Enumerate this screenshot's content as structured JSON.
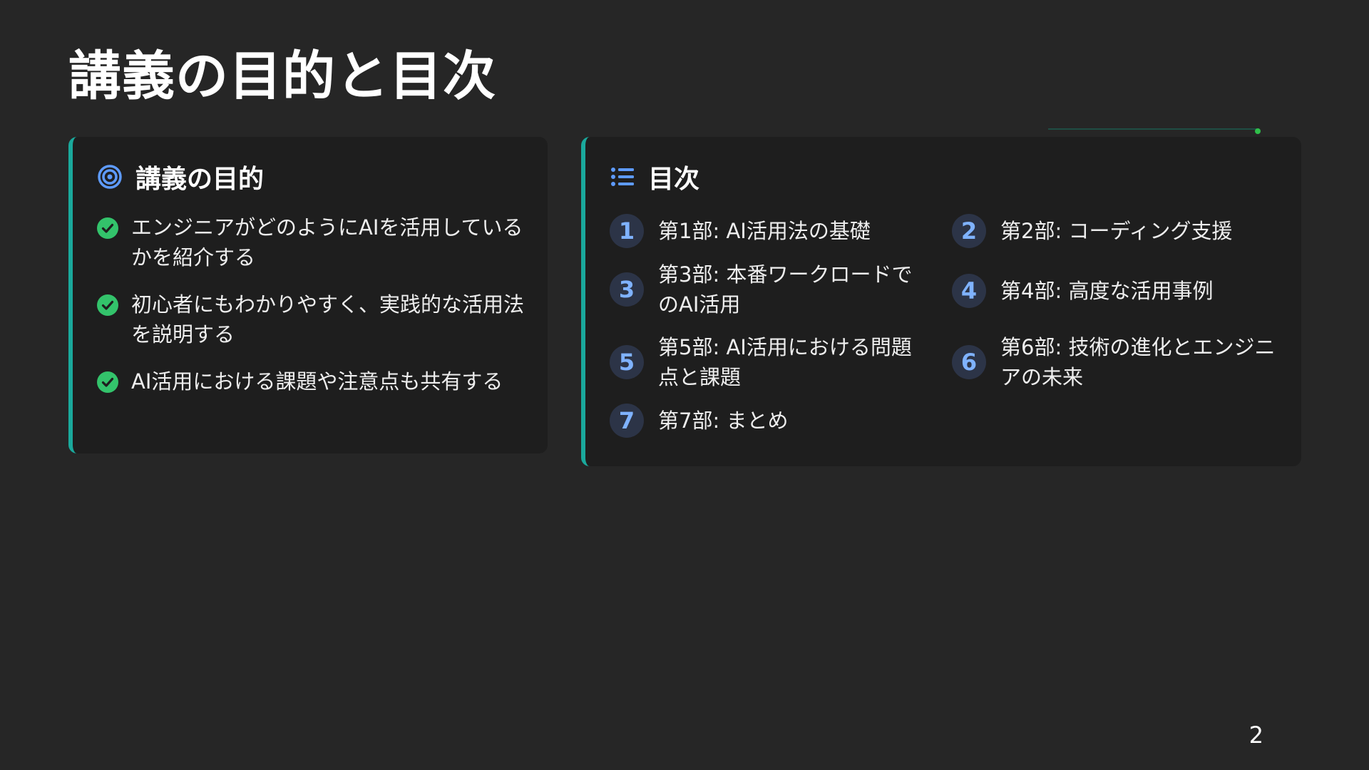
{
  "slide": {
    "title": "講義の目的と目次",
    "page_number": "2"
  },
  "objective": {
    "heading": "講義の目的",
    "icon": "target-icon",
    "items": [
      "エンジニアがどのようにAIを活用しているかを紹介する",
      "初心者にもわかりやすく、実践的な活用法を説明する",
      "AI活用における課題や注意点も共有する"
    ]
  },
  "toc": {
    "heading": "目次",
    "icon": "list-icon",
    "items": [
      {
        "number": "1",
        "label": "第1部: AI活用法の基礎"
      },
      {
        "number": "2",
        "label": "第2部: コーディング支援"
      },
      {
        "number": "3",
        "label": "第3部: 本番ワークロードでのAI活用"
      },
      {
        "number": "4",
        "label": "第4部: 高度な活用事例"
      },
      {
        "number": "5",
        "label": "第5部: AI活用における問題点と課題"
      },
      {
        "number": "6",
        "label": "第6部: 技術の進化とエンジニアの未来"
      },
      {
        "number": "7",
        "label": "第7部: まとめ"
      }
    ]
  },
  "colors": {
    "background": "#262626",
    "card": "#1e1e1e",
    "accent_border": "#1aa99c",
    "check": "#33c36b",
    "number_text": "#7fb2ff",
    "number_bg": "#2c3447"
  }
}
